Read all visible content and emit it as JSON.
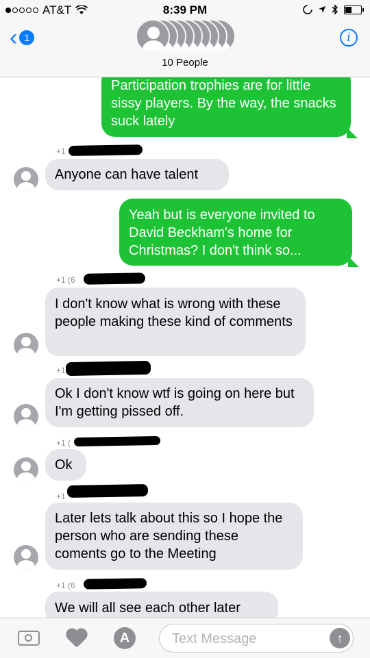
{
  "status_bar": {
    "carrier": "AT&T",
    "time": "8:39 PM"
  },
  "header": {
    "back_badge": "1",
    "group_count": "10 People",
    "info_label": "i"
  },
  "messages": [
    {
      "type": "out",
      "text": "Participation trophies are for little sissy players. By the way, the snacks suck lately"
    },
    {
      "type": "in",
      "sender": "+1",
      "text": "Anyone can have talent"
    },
    {
      "type": "out",
      "text": "Yeah but is everyone invited to David Beckham's home for Christmas? I don't think so..."
    },
    {
      "type": "in",
      "sender": "+1 (6",
      "text": "I don't know what is wrong with these people making these kind of comments"
    },
    {
      "type": "in",
      "sender": "+1",
      "text": "Ok I don't know wtf is going on here but I'm getting pissed off."
    },
    {
      "type": "in",
      "sender": "+1 (",
      "text": "Ok"
    },
    {
      "type": "in",
      "sender": "+1",
      "text": "Later lets talk about this so I hope the person who are sending these coments go to the Meeting"
    },
    {
      "type": "in",
      "sender": "+1 (6",
      "text": "We will all see each other later"
    }
  ],
  "input_bar": {
    "placeholder": "Text Message",
    "send_label": "↑",
    "appstore_label": "A"
  },
  "colors": {
    "outgoing_bubble": "#1dc335",
    "incoming_bubble": "#e5e5ea",
    "accent": "#0a7aff"
  }
}
